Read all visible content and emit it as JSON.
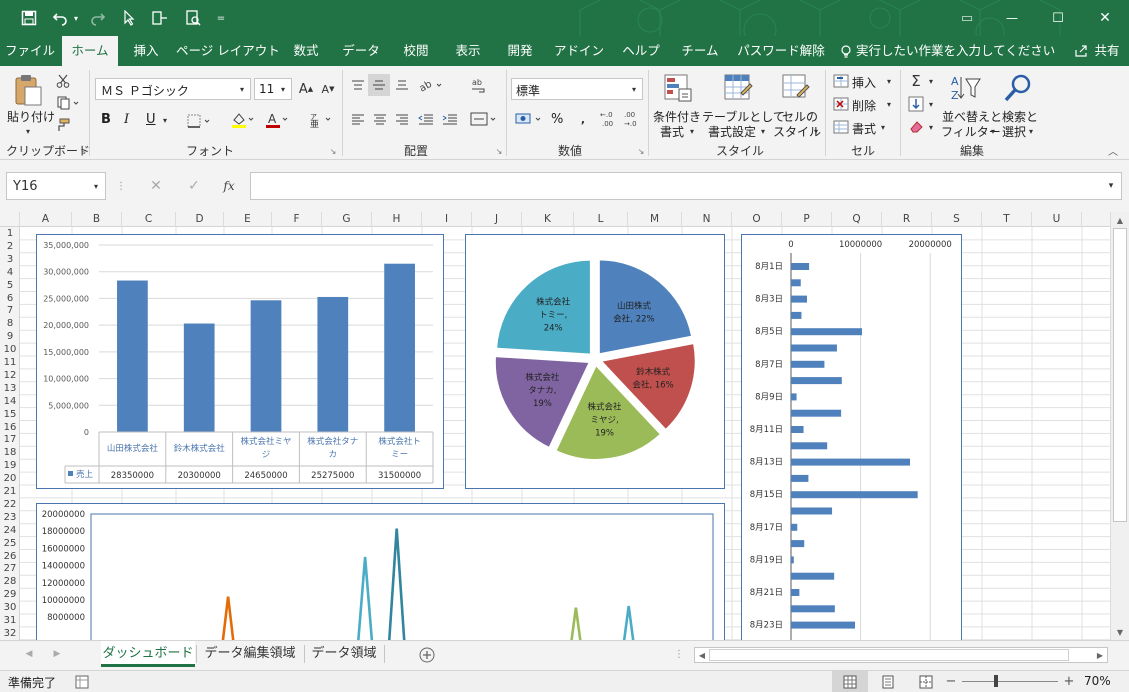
{
  "quick_access": {
    "save": "save-icon",
    "undo": "undo-icon",
    "redo": "redo-icon",
    "customize": "="
  },
  "window_controls": {
    "ribbon_display": "▭",
    "minimize": "—",
    "maximize": "☐",
    "close": "✕"
  },
  "menu": {
    "tabs": [
      "ファイル",
      "ホーム",
      "挿入",
      "ページ レイアウト",
      "数式",
      "データ",
      "校閲",
      "表示",
      "開発",
      "アドイン",
      "ヘルプ",
      "チーム",
      "パスワード解除"
    ],
    "active_tab": "ホーム",
    "tell_me": "実行したい作業を入力してください",
    "share": "共有"
  },
  "ribbon": {
    "clipboard": {
      "label": "クリップボード",
      "paste": "貼り付け"
    },
    "font": {
      "label": "フォント",
      "font_name": "ＭＳ Ｐゴシック",
      "font_size": "11",
      "bold": "B",
      "italic": "I",
      "underline": "U"
    },
    "alignment": {
      "label": "配置"
    },
    "number": {
      "label": "数値",
      "format": "標準",
      "percent": "%"
    },
    "styles": {
      "label": "スタイル",
      "conditional": [
        "条件付き",
        "書式"
      ],
      "table": [
        "テーブルとして",
        "書式設定"
      ],
      "cell_styles": [
        "セルの",
        "スタイル"
      ]
    },
    "cells": {
      "label": "セル",
      "insert": "挿入",
      "delete": "削除",
      "format": "書式"
    },
    "editing": {
      "label": "編集",
      "sort": [
        "並べ替えと",
        "フィルター"
      ],
      "find": [
        "検索と",
        "選択"
      ]
    }
  },
  "formula_bar": {
    "name_box": "Y16",
    "fx": "fx",
    "value": ""
  },
  "columns": [
    "A",
    "B",
    "C",
    "D",
    "E",
    "F",
    "G",
    "H",
    "I",
    "J",
    "K",
    "L",
    "M",
    "N",
    "O",
    "P",
    "Q",
    "R",
    "S",
    "T",
    "U"
  ],
  "rows": [
    "1",
    "2",
    "3",
    "4",
    "5",
    "6",
    "7",
    "8",
    "9",
    "10",
    "11",
    "12",
    "13",
    "14",
    "15",
    "16",
    "17",
    "18",
    "19",
    "20",
    "21",
    "22",
    "23",
    "24",
    "25",
    "26",
    "27",
    "28",
    "29",
    "30",
    "31",
    "32"
  ],
  "chart_data": [
    {
      "type": "bar",
      "categories": [
        "山田株式会社",
        "鈴木株式会社",
        "株式会社ミヤジ",
        "株式会社タナカ",
        "株式会社トミー"
      ],
      "category_lines": [
        [
          "山田株式会社"
        ],
        [
          "鈴木株式会社"
        ],
        [
          "株式会社ミヤ",
          "ジ"
        ],
        [
          "株式会社タナ",
          "カ"
        ],
        [
          "株式会社ト",
          "ミー"
        ]
      ],
      "series": [
        {
          "name": "売上",
          "values": [
            28350000,
            20300000,
            24650000,
            25275000,
            31500000
          ]
        }
      ],
      "value_labels": [
        "28350000",
        "20300000",
        "24650000",
        "25275000",
        "31500000"
      ],
      "ylim": [
        0,
        35000000
      ],
      "yticks": [
        "0",
        "5,000,000",
        "10,000,000",
        "15,000,000",
        "20,000,000",
        "25,000,000",
        "30,000,000",
        "35,000,000"
      ],
      "grid": true,
      "data_table": true,
      "color": "#4f81bd"
    },
    {
      "type": "pie",
      "categories": [
        "山田株式会社",
        "鈴木株式会社",
        "株式会社ミヤジ",
        "株式会社タナカ",
        "株式会社トミー"
      ],
      "values": [
        22,
        16,
        19,
        19,
        24
      ],
      "labels": [
        [
          "山田株式",
          "会社, 22%"
        ],
        [
          "鈴木株式",
          "会社, 16%"
        ],
        [
          "株式会社",
          "ミヤジ,",
          "19%"
        ],
        [
          "株式会社",
          "タナカ,",
          "19%"
        ],
        [
          "株式会社",
          "トミー,",
          "24%"
        ]
      ],
      "colors": [
        "#4f81bd",
        "#c0504d",
        "#9bbb59",
        "#8064a2",
        "#4bacc6"
      ],
      "exploded": true
    },
    {
      "type": "bar",
      "orientation": "horizontal",
      "xlim": [
        0,
        25000000
      ],
      "xticks": [
        "0",
        "10000000",
        "20000000"
      ],
      "category_labels": [
        "8月1日",
        "8月3日",
        "8月5日",
        "8月7日",
        "8月9日",
        "8月11日",
        "8月13日",
        "8月15日",
        "8月17日",
        "8月19日",
        "8月21日",
        "8月23日"
      ],
      "values": [
        2600000,
        1400000,
        2300000,
        1500000,
        10200000,
        6600000,
        4800000,
        7300000,
        800000,
        7200000,
        1800000,
        5200000,
        17100000,
        2500000,
        18200000,
        5900000,
        900000,
        1900000,
        400000,
        6200000,
        1200000,
        6300000,
        9200000,
        0
      ],
      "color": "#4f81bd"
    },
    {
      "type": "line",
      "ylim": [
        0,
        20000000
      ],
      "yticks": [
        "8000000",
        "10000000",
        "12000000",
        "14000000",
        "16000000",
        "18000000",
        "20000000"
      ],
      "x_count": 60,
      "series": [
        {
          "color": "#e36c09",
          "values": [
            0,
            0,
            0,
            0,
            0,
            0,
            0,
            0,
            0,
            0,
            0,
            0,
            0,
            10400000,
            0,
            0,
            0,
            0,
            0,
            0,
            0,
            0,
            0,
            0,
            0,
            0,
            0,
            0,
            0,
            0,
            0,
            0,
            0,
            0,
            0,
            0,
            0,
            0,
            0,
            0,
            0,
            0,
            0,
            0,
            0,
            0,
            0,
            0,
            0,
            0,
            0,
            0,
            0,
            0,
            0,
            0,
            0,
            0,
            0,
            0
          ]
        },
        {
          "color": "#4bacc6",
          "values": [
            0,
            0,
            0,
            0,
            0,
            0,
            0,
            0,
            0,
            0,
            0,
            0,
            0,
            0,
            0,
            0,
            0,
            0,
            0,
            0,
            0,
            0,
            0,
            0,
            0,
            0,
            15000000,
            0,
            0,
            0,
            0,
            0,
            0,
            0,
            0,
            0,
            0,
            0,
            0,
            0,
            0,
            0,
            0,
            0,
            0,
            0,
            0,
            0,
            0,
            0,
            0,
            9300000,
            0,
            0,
            0,
            0,
            0,
            0,
            0,
            0
          ]
        },
        {
          "color": "#31859c",
          "values": [
            0,
            0,
            0,
            0,
            0,
            0,
            0,
            0,
            0,
            0,
            0,
            0,
            0,
            0,
            0,
            0,
            0,
            0,
            0,
            0,
            0,
            0,
            0,
            0,
            0,
            0,
            0,
            0,
            0,
            18300000,
            0,
            0,
            0,
            0,
            0,
            0,
            0,
            0,
            0,
            0,
            0,
            0,
            0,
            0,
            0,
            0,
            0,
            0,
            0,
            0,
            0,
            0,
            0,
            0,
            0,
            0,
            0,
            0,
            0,
            0
          ]
        },
        {
          "color": "#9bbb59",
          "values": [
            0,
            0,
            0,
            0,
            0,
            0,
            0,
            0,
            0,
            0,
            0,
            0,
            0,
            0,
            0,
            0,
            0,
            0,
            0,
            0,
            0,
            0,
            0,
            0,
            0,
            0,
            0,
            0,
            0,
            0,
            0,
            0,
            0,
            0,
            0,
            0,
            0,
            0,
            0,
            0,
            0,
            0,
            0,
            0,
            0,
            0,
            9100000,
            0,
            0,
            0,
            0,
            0,
            0,
            0,
            0,
            0,
            0,
            0,
            0,
            0
          ]
        }
      ]
    }
  ],
  "sheets": {
    "tabs": [
      "ダッシュボード",
      "データ編集領域",
      "データ領域"
    ],
    "active": "ダッシュボード"
  },
  "status": {
    "ready": "準備完了",
    "zoom": "70%",
    "minus": "−",
    "plus": "+"
  }
}
